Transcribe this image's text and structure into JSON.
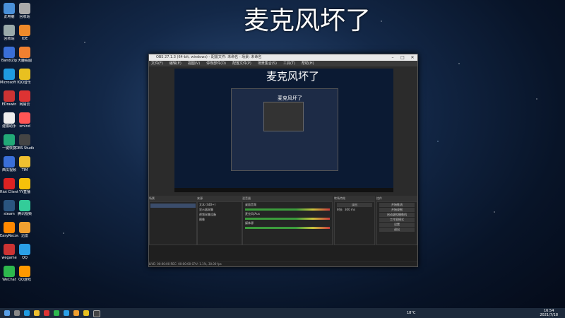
{
  "desktop_title": "麦克风坏了",
  "desktop_icons": [
    {
      "label": "此电脑",
      "color": "#4a90d9"
    },
    {
      "label": "回收站",
      "color": "#9aa"
    },
    {
      "label": "BandiZip",
      "color": "#3a6fd8"
    },
    {
      "label": "Microsoft Edge",
      "color": "#1f9be0"
    },
    {
      "label": "EDrawin",
      "color": "#c33"
    },
    {
      "label": "建模助手",
      "color": "#eee"
    },
    {
      "label": "一键恢复",
      "color": "#2a7"
    },
    {
      "label": "西瓜视频",
      "color": "#3a6fd8"
    },
    {
      "label": "Riot Client",
      "color": "#d22"
    },
    {
      "label": "steam",
      "color": "#2a5580"
    },
    {
      "label": "EasyRecovery",
      "color": "#f80"
    },
    {
      "label": "wegame",
      "color": "#c33"
    },
    {
      "label": "WeChat",
      "color": "#2db84d"
    },
    {
      "label": "回收站",
      "color": "#aaa"
    },
    {
      "label": "IDE",
      "color": "#ee8a2a"
    },
    {
      "label": "大鹿看图",
      "color": "#f08030"
    },
    {
      "label": "QQ音乐",
      "color": "#e8c020"
    },
    {
      "label": "网易云",
      "color": "#d33"
    },
    {
      "label": "xmind",
      "color": "#f55"
    },
    {
      "label": "OBS Studio",
      "color": "#444"
    },
    {
      "label": "TIM",
      "color": "#f0c030"
    },
    {
      "label": "YY直播",
      "color": "#f5c10a"
    },
    {
      "label": "腾讯视频",
      "color": "#3c9"
    },
    {
      "label": "迅雷",
      "color": "#f0a030"
    },
    {
      "label": "QQ",
      "color": "#2aa0e8"
    },
    {
      "label": "QQ游戏",
      "color": "#f90"
    }
  ],
  "obs": {
    "title": "OBS 27.1.3 (64-bit, windows) - 配置文件: 未命名 - 场景: 未命名",
    "menu": [
      "文件(F)",
      "编辑(E)",
      "视图(V)",
      "停靠部件(D)",
      "配置文件(P)",
      "场景集合(S)",
      "工具(T)",
      "帮助(H)"
    ],
    "preview_title": "麦克风坏了",
    "nested_title": "麦克风坏了",
    "docks": {
      "scenes": "场景",
      "sources": "来源",
      "mixer": "混音器",
      "transitions": "转场特效",
      "controls": "控件"
    },
    "sources_list": [
      "文本 (GDI+)",
      "显示器采集",
      "视频采集设备",
      "图像"
    ],
    "mixer_tracks": [
      "桌面音频",
      "麦克风/Aux",
      "媒体源"
    ],
    "transition_value": "淡出",
    "duration_label": "时长",
    "duration_value": "300 ms",
    "controls": [
      "开始推流",
      "开始录制",
      "启动虚拟摄像机",
      "工作室模式",
      "设置",
      "退出"
    ],
    "status": "LIVE: 00:00:00   REC: 00:00:00   CPU: 1.1%, 30.00 fps"
  },
  "taskbar": {
    "temperature": "18°C",
    "time": "16:54",
    "date": "2021/7/18"
  }
}
